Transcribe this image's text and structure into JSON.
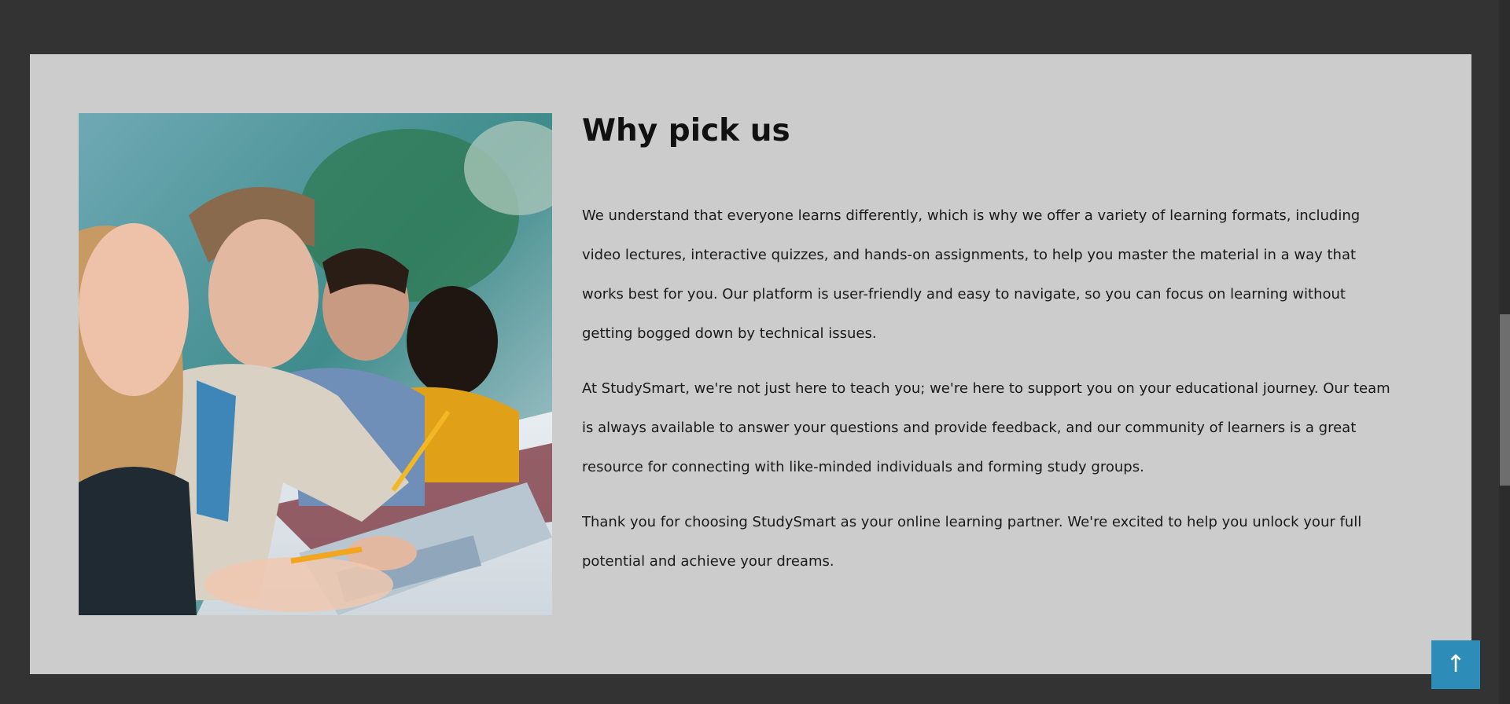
{
  "section": {
    "heading": "Why pick us",
    "paragraphs": [
      "We understand that everyone learns differently, which is why we offer a variety of learning formats, including video lectures, interactive quizzes, and hands-on assignments, to help you master the material in a way that works best for you. Our platform is user-friendly and easy to navigate, so you can focus on learning without getting bogged down by technical issues.",
      "At StudySmart, we're not just here to teach you; we're here to support you on your educational journey. Our team is always available to answer your questions and provide feedback, and our community of learners is a great resource for connecting with like-minded individuals and forming study groups.",
      "Thank you for choosing StudySmart as your online learning partner. We're excited to help you unlock your full potential and achieve your dreams."
    ],
    "image_subject": "students-writing-in-classroom-photo"
  },
  "controls": {
    "scroll_top_symbol": "↑",
    "scroll_top_icon": "arrow-up-icon"
  },
  "colors": {
    "page_background": "#333333",
    "panel_background": "#cccccc",
    "accent_button": "#2e8cb8",
    "text": "#111111"
  }
}
